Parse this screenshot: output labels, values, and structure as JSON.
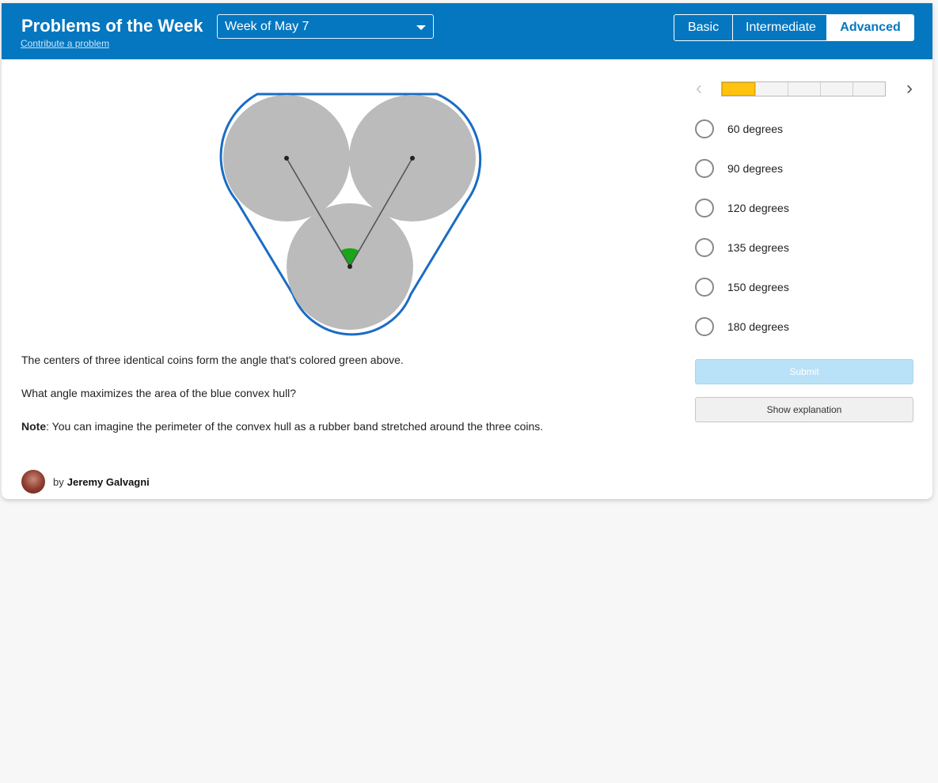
{
  "header": {
    "title": "Problems of the Week",
    "contribute_link": "Contribute a problem",
    "week_select": {
      "selected": "Week of May 7"
    },
    "levels": [
      {
        "label": "Basic",
        "active": false
      },
      {
        "label": "Intermediate",
        "active": false
      },
      {
        "label": "Advanced",
        "active": true
      }
    ]
  },
  "problem": {
    "line1": "The centers of three identical coins form the angle that's colored green above.",
    "line2": "What angle maximizes the area of the blue convex hull?",
    "note_label": "Note",
    "note_text": ": You can imagine the perimeter of the convex hull as a rubber band stretched around the three coins."
  },
  "author": {
    "by": "by",
    "name": "Jeremy Galvagni"
  },
  "progress": {
    "segments": 5,
    "current": 1
  },
  "choices": [
    "60 degrees",
    "90 degrees",
    "120 degrees",
    "135 degrees",
    "150 degrees",
    "180 degrees"
  ],
  "buttons": {
    "submit": "Submit",
    "explain": "Show explanation"
  },
  "colors": {
    "header": "#0477c0",
    "hull": "#1a6cc4",
    "coin": "#bbbbbb",
    "angle": "#1aa51a",
    "progress_fill": "#ffc310"
  },
  "icons": {
    "prev": "chevron-left-icon",
    "next": "chevron-right-icon",
    "dropdown": "caret-down-icon"
  }
}
